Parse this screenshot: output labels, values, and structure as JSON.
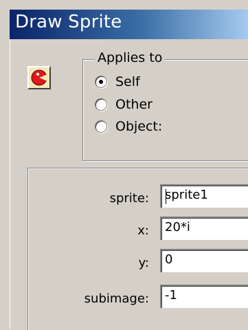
{
  "window": {
    "title": "Draw Sprite"
  },
  "action": {
    "icon": "draw-sprite-icon",
    "icon_color": "#e01818"
  },
  "applies_to": {
    "legend": "Applies to",
    "options": [
      {
        "label": "Self",
        "selected": true
      },
      {
        "label": "Other",
        "selected": false
      },
      {
        "label": "Object:",
        "selected": false
      }
    ]
  },
  "fields": [
    {
      "label": "sprite:",
      "value": "sprite1"
    },
    {
      "label": "x:",
      "value": "20*i"
    },
    {
      "label": "y:",
      "value": "0"
    },
    {
      "label": "subimage:",
      "value": "-1"
    }
  ]
}
